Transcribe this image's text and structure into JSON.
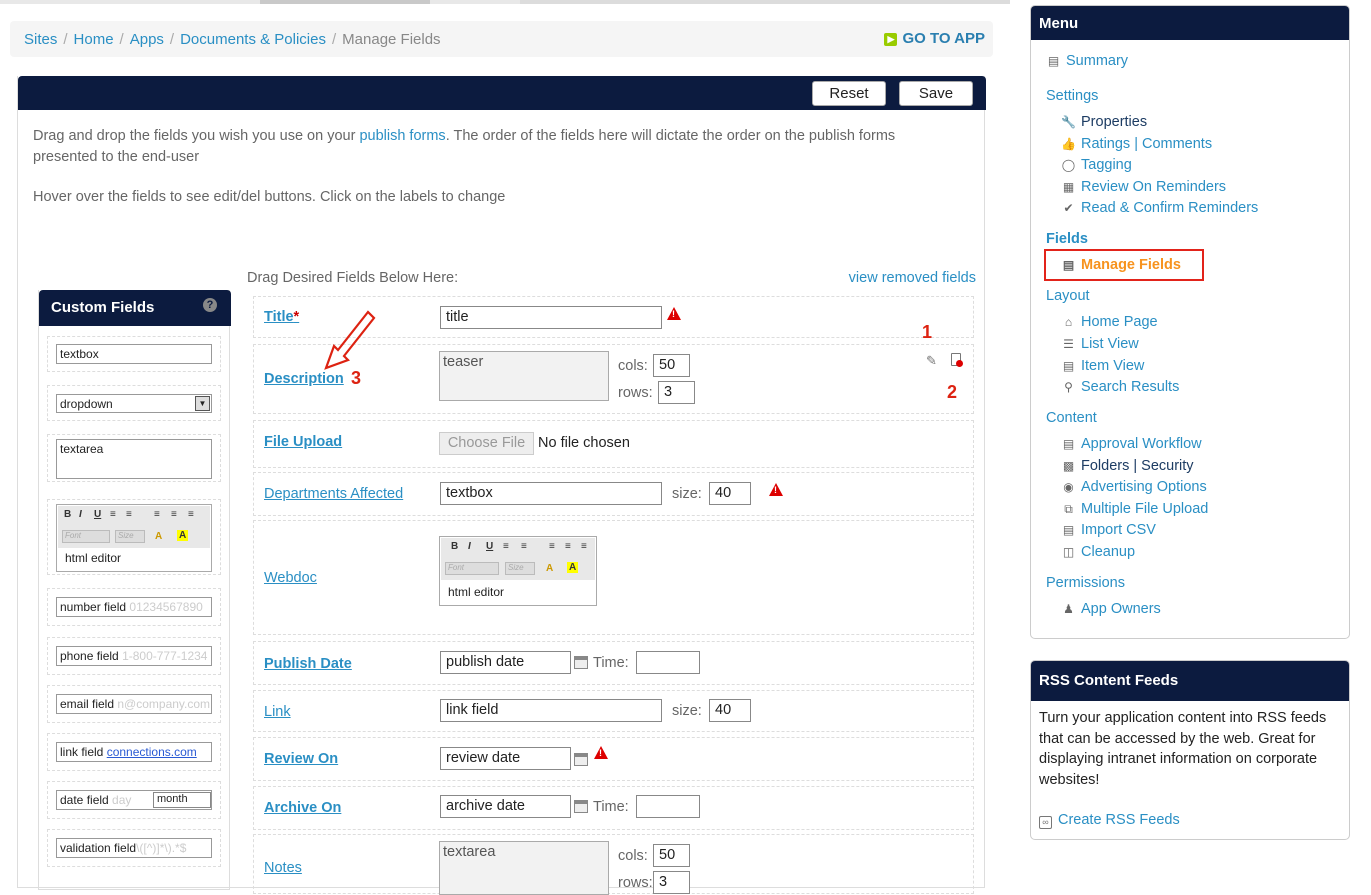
{
  "breadcrumb": {
    "items": [
      "Sites",
      "Home",
      "Apps",
      "Documents & Policies"
    ],
    "current": "Manage Fields",
    "separator": "/"
  },
  "go_to_app": "GO TO APP",
  "toolbar": {
    "reset": "Reset",
    "save": "Save"
  },
  "intro": {
    "line1_prefix": "Drag and drop the fields you wish you use on your ",
    "line1_link": "publish forms",
    "line1_suffix": ". The order of the fields here will dictate the order on the publish forms presented to the end-user",
    "line2": "Hover over the fields to see edit/del buttons. Click on the labels to change"
  },
  "custom_fields": {
    "title": "Custom Fields",
    "help": "?",
    "textbox": "textbox",
    "dropdown": "dropdown",
    "textarea": "textarea",
    "editor_text": "html editor",
    "editor_font": "Font",
    "editor_size": "Size",
    "number": {
      "label": "number field",
      "hint": "01234567890"
    },
    "phone": {
      "label": "phone field",
      "hint": "1-800-777-1234"
    },
    "email": {
      "label": "email field",
      "hint": "n@company.com"
    },
    "linkf": {
      "label": "link field",
      "hint": "connections.com"
    },
    "date": {
      "label": "date field",
      "hint": "day",
      "month": "month"
    },
    "validation": {
      "label": "validation field",
      "hint": "\\([^)]*\\).*$"
    }
  },
  "drag_area": {
    "label": "Drag Desired Fields Below Here:",
    "view_removed": "view removed fields"
  },
  "fields": {
    "title": {
      "label": "Title",
      "required": "*",
      "value": "title"
    },
    "description": {
      "label": "Description",
      "value": "teaser",
      "cols_label": "cols:",
      "cols": "50",
      "rows_label": "rows:",
      "rows": "3"
    },
    "file_upload": {
      "label": "File Upload",
      "button": "Choose File",
      "status": "No file chosen"
    },
    "departments": {
      "label": "Departments Affected",
      "value": "textbox",
      "size_label": "size:",
      "size": "40"
    },
    "webdoc": {
      "label": "Webdoc",
      "editor_text": "html editor",
      "editor_font": "Font",
      "editor_size": "Size"
    },
    "publish_date": {
      "label": "Publish Date",
      "value": "publish date",
      "time_label": "Time:"
    },
    "link": {
      "label": "Link",
      "value": "link field",
      "size_label": "size:",
      "size": "40"
    },
    "review_on": {
      "label": "Review On",
      "value": "review date"
    },
    "archive_on": {
      "label": "Archive On",
      "value": "archive date",
      "time_label": "Time:"
    },
    "notes": {
      "label": "Notes",
      "value": "textarea",
      "cols_label": "cols:",
      "cols": "50",
      "rows_label": "rows:",
      "rows": "3"
    }
  },
  "annotations": {
    "one": "1",
    "two": "2",
    "three": "3"
  },
  "menu": {
    "title": "Menu",
    "summary": "Summary",
    "settings": "Settings",
    "properties": "Properties",
    "ratings": "Ratings | Comments",
    "tagging": "Tagging",
    "review_reminders": "Review On Reminders",
    "read_confirm": "Read & Confirm Reminders",
    "fields": "Fields",
    "manage_fields": "Manage Fields",
    "layout": "Layout",
    "home_page": "Home Page",
    "list_view": "List View",
    "item_view": "Item View",
    "search_results": "Search Results",
    "content": "Content",
    "approval": "Approval Workflow",
    "folders": "Folders | Security",
    "advertising": "Advertising Options",
    "multi_upload": "Multiple File Upload",
    "import_csv": "Import CSV",
    "cleanup": "Cleanup",
    "permissions": "Permissions",
    "app_owners": "App Owners"
  },
  "rss": {
    "title": "RSS Content Feeds",
    "text": "Turn your application content into RSS feeds that can be accessed by the web. Great for displaying intranet information on corporate websites!",
    "link": "Create RSS Feeds"
  },
  "colors": {
    "navy": "#0c1b3f",
    "link": "#2a8fc4",
    "selected": "#f7931e",
    "highlight_box": "#e2231a",
    "warning": "#dd0000"
  }
}
